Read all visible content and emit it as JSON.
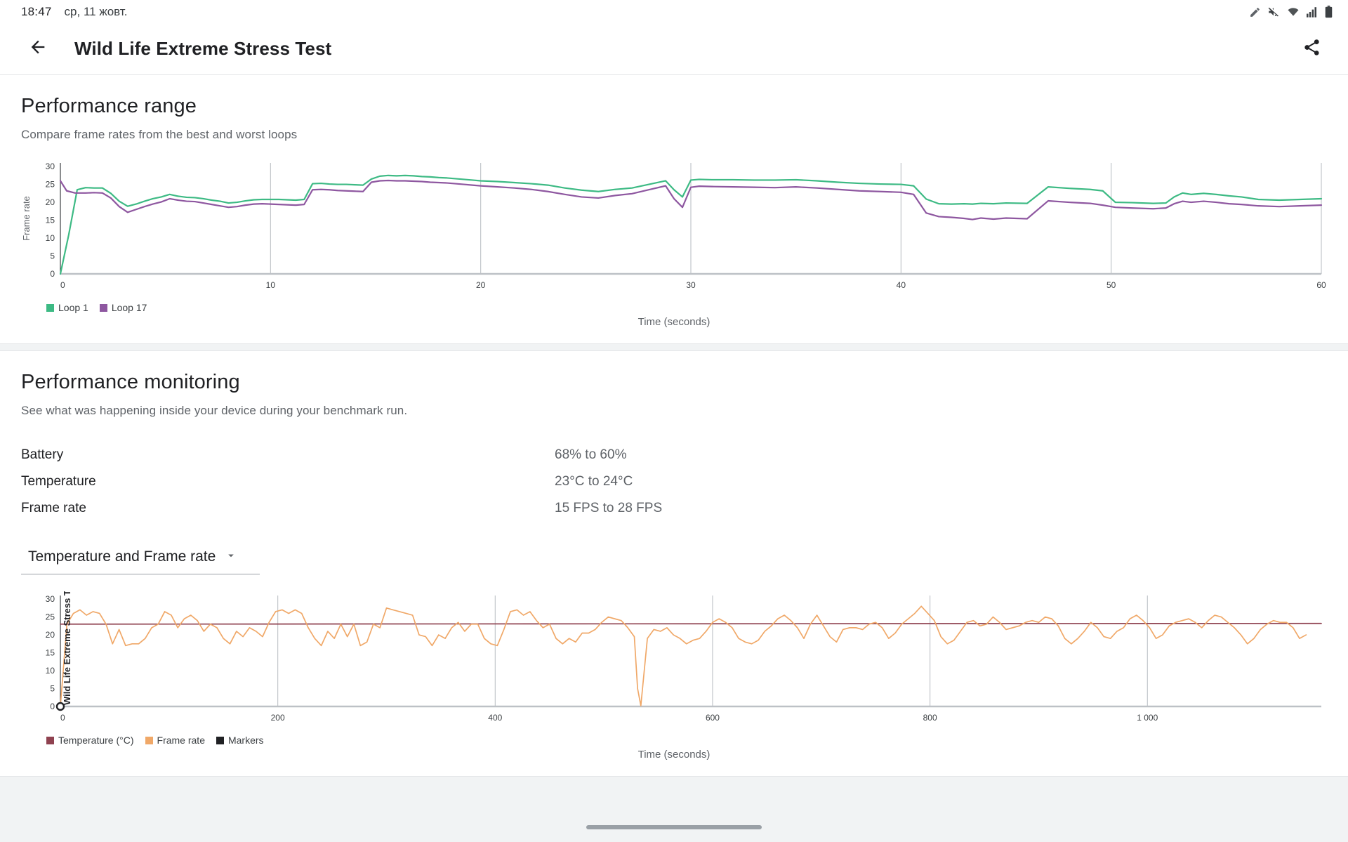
{
  "status_bar": {
    "time": "18:47",
    "date": "ср, 11 жовт.",
    "icons": [
      "pencil-icon",
      "volume-mute-icon",
      "wifi-icon",
      "cellular-signal-icon",
      "battery-icon"
    ]
  },
  "app_bar": {
    "back_icon": "back-arrow-icon",
    "title": "Wild Life Extreme Stress Test",
    "share_icon": "share-icon"
  },
  "performance_range": {
    "title": "Performance range",
    "subtitle": "Compare frame rates from the best and worst loops",
    "x_caption": "Time (seconds)"
  },
  "performance_monitoring": {
    "title": "Performance monitoring",
    "subtitle": "See what was happening inside your device during your benchmark run.",
    "x_caption": "Time (seconds)",
    "inline_label": "Wild Life Extreme Stress Test",
    "stats": [
      {
        "label": "Battery",
        "value": "68% to 60%"
      },
      {
        "label": "Temperature",
        "value": "23°C to 24°C"
      },
      {
        "label": "Frame rate",
        "value": "15 FPS to 28 FPS"
      }
    ],
    "dropdown": {
      "value": "Temperature and Frame rate",
      "caret_icon": "chevron-down-icon"
    }
  },
  "colors": {
    "loop1": "#3dba84",
    "loop17": "#8e57a0",
    "temperature": "#8f4250",
    "frame_rate": "#f0a868",
    "markers": "#202124",
    "grid": "#bdc1c6",
    "axis": "#9aa0a6",
    "text_primary": "#202124",
    "text_secondary": "#5f6368"
  },
  "chart_data": [
    {
      "type": "line",
      "id": "performance-range-chart",
      "title": "Performance range",
      "xlabel": "Time (seconds)",
      "ylabel": "Frame rate",
      "xlim": [
        0,
        60
      ],
      "ylim": [
        0,
        31
      ],
      "xticks": [
        0,
        10,
        20,
        30,
        40,
        50,
        60
      ],
      "yticks": [
        0,
        5,
        10,
        15,
        20,
        25,
        30
      ],
      "grid": "vertical",
      "legend_position": "bottom-left",
      "legend": [
        "Loop 1",
        "Loop 17"
      ],
      "series": [
        {
          "name": "Loop 1",
          "color": "#3dba84",
          "x": [
            0.0,
            0.4,
            0.8,
            1.2,
            1.6,
            2.0,
            2.4,
            2.8,
            3.2,
            3.6,
            4.0,
            4.4,
            4.8,
            5.2,
            5.6,
            6.0,
            6.4,
            6.8,
            7.2,
            7.6,
            8.0,
            8.4,
            8.8,
            9.2,
            9.6,
            10.0,
            10.4,
            10.8,
            11.2,
            11.6,
            12.0,
            12.4,
            12.8,
            13.2,
            13.6,
            14.0,
            14.4,
            14.8,
            15.2,
            15.6,
            16.0,
            16.4,
            16.8,
            17.2,
            17.6,
            18.0,
            18.4,
            18.8,
            19.2,
            19.6,
            20.0,
            20.8,
            21.6,
            22.4,
            23.2,
            24.0,
            24.8,
            25.6,
            26.4,
            27.2,
            28.0,
            28.8,
            29.2,
            29.6,
            30.0,
            30.4,
            31.0,
            32.0,
            33.0,
            34.0,
            35.0,
            36.0,
            37.0,
            38.0,
            39.0,
            40.0,
            40.6,
            41.2,
            41.8,
            42.4,
            43.0,
            43.4,
            43.8,
            44.4,
            45.0,
            46.0,
            47.0,
            48.0,
            49.0,
            49.6,
            50.2,
            51.0,
            52.0,
            52.6,
            53.0,
            53.4,
            53.8,
            54.4,
            55.0,
            55.6,
            56.2,
            57.0,
            58.0,
            59.0,
            60.0
          ],
          "y": [
            0.0,
            11.0,
            23.5,
            24.1,
            24.0,
            24.0,
            22.5,
            20.3,
            18.9,
            19.5,
            20.3,
            21.0,
            21.5,
            22.2,
            21.7,
            21.4,
            21.3,
            21.0,
            20.6,
            20.3,
            19.8,
            20.0,
            20.4,
            20.7,
            20.8,
            20.8,
            20.8,
            20.7,
            20.6,
            20.8,
            25.2,
            25.3,
            25.1,
            25.0,
            25.0,
            24.9,
            24.8,
            26.5,
            27.3,
            27.5,
            27.4,
            27.5,
            27.4,
            27.2,
            27.1,
            26.9,
            26.8,
            26.6,
            26.4,
            26.2,
            26.0,
            25.8,
            25.5,
            25.2,
            24.8,
            24.0,
            23.4,
            23.0,
            23.6,
            24.0,
            25.0,
            26.0,
            23.5,
            21.5,
            26.2,
            26.4,
            26.3,
            26.3,
            26.2,
            26.2,
            26.3,
            26.0,
            25.6,
            25.3,
            25.1,
            25.0,
            24.6,
            20.9,
            19.6,
            19.5,
            19.6,
            19.5,
            19.7,
            19.6,
            19.8,
            19.7,
            24.3,
            23.9,
            23.6,
            23.2,
            20.0,
            19.9,
            19.7,
            19.8,
            21.5,
            22.6,
            22.2,
            22.5,
            22.2,
            21.8,
            21.5,
            20.8,
            20.6,
            20.8,
            21.0
          ]
        },
        {
          "name": "Loop 17",
          "color": "#8e57a0",
          "x": [
            0.0,
            0.3,
            0.7,
            1.2,
            1.6,
            2.0,
            2.4,
            2.8,
            3.2,
            3.6,
            4.0,
            4.4,
            4.8,
            5.2,
            5.6,
            6.0,
            6.4,
            6.8,
            7.2,
            7.6,
            8.0,
            8.4,
            8.8,
            9.2,
            9.6,
            10.0,
            10.4,
            10.8,
            11.2,
            11.6,
            12.0,
            12.4,
            12.8,
            13.2,
            13.6,
            14.0,
            14.4,
            14.8,
            15.2,
            15.6,
            16.0,
            16.4,
            16.8,
            17.2,
            17.6,
            18.0,
            18.4,
            18.8,
            19.2,
            19.6,
            20.0,
            20.8,
            21.6,
            22.4,
            23.2,
            24.0,
            24.8,
            25.6,
            26.4,
            27.2,
            28.0,
            28.8,
            29.2,
            29.6,
            30.0,
            30.4,
            31.0,
            32.0,
            33.0,
            34.0,
            35.0,
            36.0,
            37.0,
            38.0,
            39.0,
            40.0,
            40.6,
            41.2,
            41.8,
            42.4,
            43.0,
            43.4,
            43.8,
            44.4,
            45.0,
            46.0,
            47.0,
            48.0,
            49.0,
            49.6,
            50.2,
            51.0,
            52.0,
            52.6,
            53.0,
            53.4,
            53.8,
            54.4,
            55.0,
            55.6,
            56.2,
            57.0,
            58.0,
            59.0,
            60.0
          ],
          "y": [
            26.0,
            23.2,
            22.6,
            22.6,
            22.7,
            22.6,
            21.2,
            18.8,
            17.2,
            18.0,
            18.8,
            19.5,
            20.1,
            21.0,
            20.6,
            20.3,
            20.2,
            19.8,
            19.4,
            19.0,
            18.6,
            18.8,
            19.2,
            19.5,
            19.6,
            19.5,
            19.4,
            19.3,
            19.2,
            19.4,
            23.5,
            23.6,
            23.5,
            23.3,
            23.2,
            23.1,
            23.0,
            25.6,
            26.0,
            26.1,
            26.0,
            26.0,
            25.9,
            25.8,
            25.6,
            25.5,
            25.4,
            25.2,
            25.0,
            24.8,
            24.6,
            24.3,
            24.0,
            23.6,
            23.0,
            22.2,
            21.5,
            21.2,
            21.9,
            22.4,
            23.5,
            24.6,
            21.0,
            18.6,
            24.2,
            24.5,
            24.4,
            24.3,
            24.2,
            24.1,
            24.3,
            24.0,
            23.6,
            23.2,
            23.0,
            22.8,
            22.2,
            17.0,
            16.0,
            15.8,
            15.5,
            15.2,
            15.6,
            15.3,
            15.6,
            15.4,
            20.4,
            20.0,
            19.7,
            19.2,
            18.6,
            18.4,
            18.2,
            18.4,
            19.6,
            20.3,
            20.0,
            20.3,
            20.0,
            19.6,
            19.4,
            19.0,
            18.8,
            19.0,
            19.2
          ]
        }
      ]
    },
    {
      "type": "line",
      "id": "performance-monitoring-chart",
      "title": "Temperature and Frame rate",
      "xlabel": "Time (seconds)",
      "ylabel": "",
      "inline_label": "Wild Life Extreme Stress Test",
      "xlim": [
        0,
        1160
      ],
      "ylim": [
        0,
        31
      ],
      "xticks": [
        0,
        200,
        400,
        600,
        800,
        1000
      ],
      "xtick_labels": [
        "0",
        "200",
        "400",
        "600",
        "800",
        "1 000"
      ],
      "yticks": [
        0,
        5,
        10,
        15,
        20,
        25,
        30
      ],
      "grid": "vertical",
      "legend_position": "bottom-left",
      "legend": [
        "Temperature (°C)",
        "Frame rate",
        "Markers"
      ],
      "series": [
        {
          "name": "Temperature (°C)",
          "color": "#8f4250",
          "x": [
            0,
            1160
          ],
          "y": [
            23.0,
            23.2
          ]
        },
        {
          "name": "Frame rate",
          "color": "#f0a868",
          "x": [
            0,
            6,
            12,
            18,
            24,
            30,
            36,
            42,
            48,
            54,
            60,
            66,
            72,
            78,
            84,
            90,
            96,
            102,
            108,
            114,
            120,
            126,
            132,
            138,
            144,
            150,
            156,
            162,
            168,
            174,
            180,
            186,
            192,
            198,
            204,
            210,
            216,
            222,
            228,
            234,
            240,
            246,
            252,
            258,
            264,
            270,
            276,
            282,
            288,
            294,
            300,
            306,
            312,
            318,
            324,
            330,
            336,
            342,
            348,
            354,
            360,
            366,
            372,
            378,
            384,
            390,
            396,
            402,
            408,
            414,
            420,
            426,
            432,
            438,
            444,
            450,
            456,
            462,
            468,
            474,
            480,
            486,
            492,
            498,
            504,
            510,
            516,
            522,
            528,
            531,
            534,
            540,
            546,
            552,
            558,
            564,
            570,
            576,
            582,
            588,
            594,
            600,
            606,
            612,
            618,
            624,
            630,
            636,
            642,
            648,
            654,
            660,
            666,
            672,
            678,
            684,
            690,
            696,
            702,
            708,
            714,
            720,
            726,
            732,
            738,
            744,
            750,
            756,
            762,
            768,
            774,
            780,
            786,
            792,
            798,
            804,
            810,
            816,
            822,
            828,
            834,
            840,
            846,
            852,
            858,
            864,
            870,
            876,
            882,
            888,
            894,
            900,
            906,
            912,
            918,
            924,
            930,
            936,
            942,
            948,
            954,
            960,
            966,
            972,
            978,
            984,
            990,
            996,
            1002,
            1008,
            1014,
            1020,
            1026,
            1032,
            1038,
            1044,
            1050,
            1056,
            1062,
            1068,
            1074,
            1080,
            1086,
            1092,
            1098,
            1104,
            1110,
            1116,
            1122,
            1128,
            1134,
            1140,
            1146,
            1152,
            1158
          ],
          "y": [
            0,
            23,
            26,
            27,
            25.5,
            26.5,
            26,
            23,
            17.5,
            21.5,
            17,
            17.5,
            17.5,
            19,
            22,
            23,
            26.5,
            25.5,
            22,
            24.5,
            25.5,
            24,
            21,
            23,
            22,
            19,
            17.5,
            21,
            19.5,
            22,
            21,
            19.5,
            23.5,
            26.5,
            27,
            26,
            27,
            26,
            22,
            19,
            17,
            21,
            19,
            23,
            19.5,
            23,
            17,
            18,
            23,
            22,
            27.5,
            27,
            26.5,
            26,
            25.5,
            20,
            19.5,
            17,
            20,
            19,
            22,
            23.5,
            21,
            23,
            23,
            19,
            17.5,
            17,
            21.5,
            26.5,
            27,
            25.5,
            26.5,
            24,
            22,
            23,
            19,
            17.5,
            19,
            18,
            20.5,
            20.5,
            21.5,
            23.5,
            25,
            24.5,
            24,
            22,
            19.5,
            5,
            0.2,
            19,
            21.5,
            21,
            22,
            20,
            19,
            17.5,
            18.5,
            19,
            21,
            23.5,
            24.5,
            23.5,
            22,
            19,
            18,
            17.5,
            18.5,
            21,
            22.5,
            24.5,
            25.5,
            24,
            22,
            19,
            23,
            25.5,
            22.5,
            19.5,
            18,
            21.5,
            22,
            22,
            21.5,
            23,
            23.5,
            22,
            19,
            20.5,
            23,
            24.5,
            26,
            28,
            26,
            24,
            19.5,
            17.5,
            18.5,
            21,
            23.5,
            24,
            22.5,
            23,
            25,
            23.5,
            21.5,
            22,
            22.5,
            23.5,
            24,
            23.5,
            25,
            24.5,
            22.5,
            19,
            17.5,
            19,
            21,
            23.5,
            22,
            19.5,
            19,
            21,
            22,
            24.5,
            25.5,
            24,
            22,
            19,
            20,
            22.5,
            23.5,
            24,
            24.5,
            23.5,
            22,
            24,
            25.5,
            25,
            23.5,
            22,
            20,
            17.5,
            19,
            21.5,
            23,
            24,
            23.5,
            23.5,
            22,
            19,
            20
          ]
        }
      ]
    }
  ]
}
